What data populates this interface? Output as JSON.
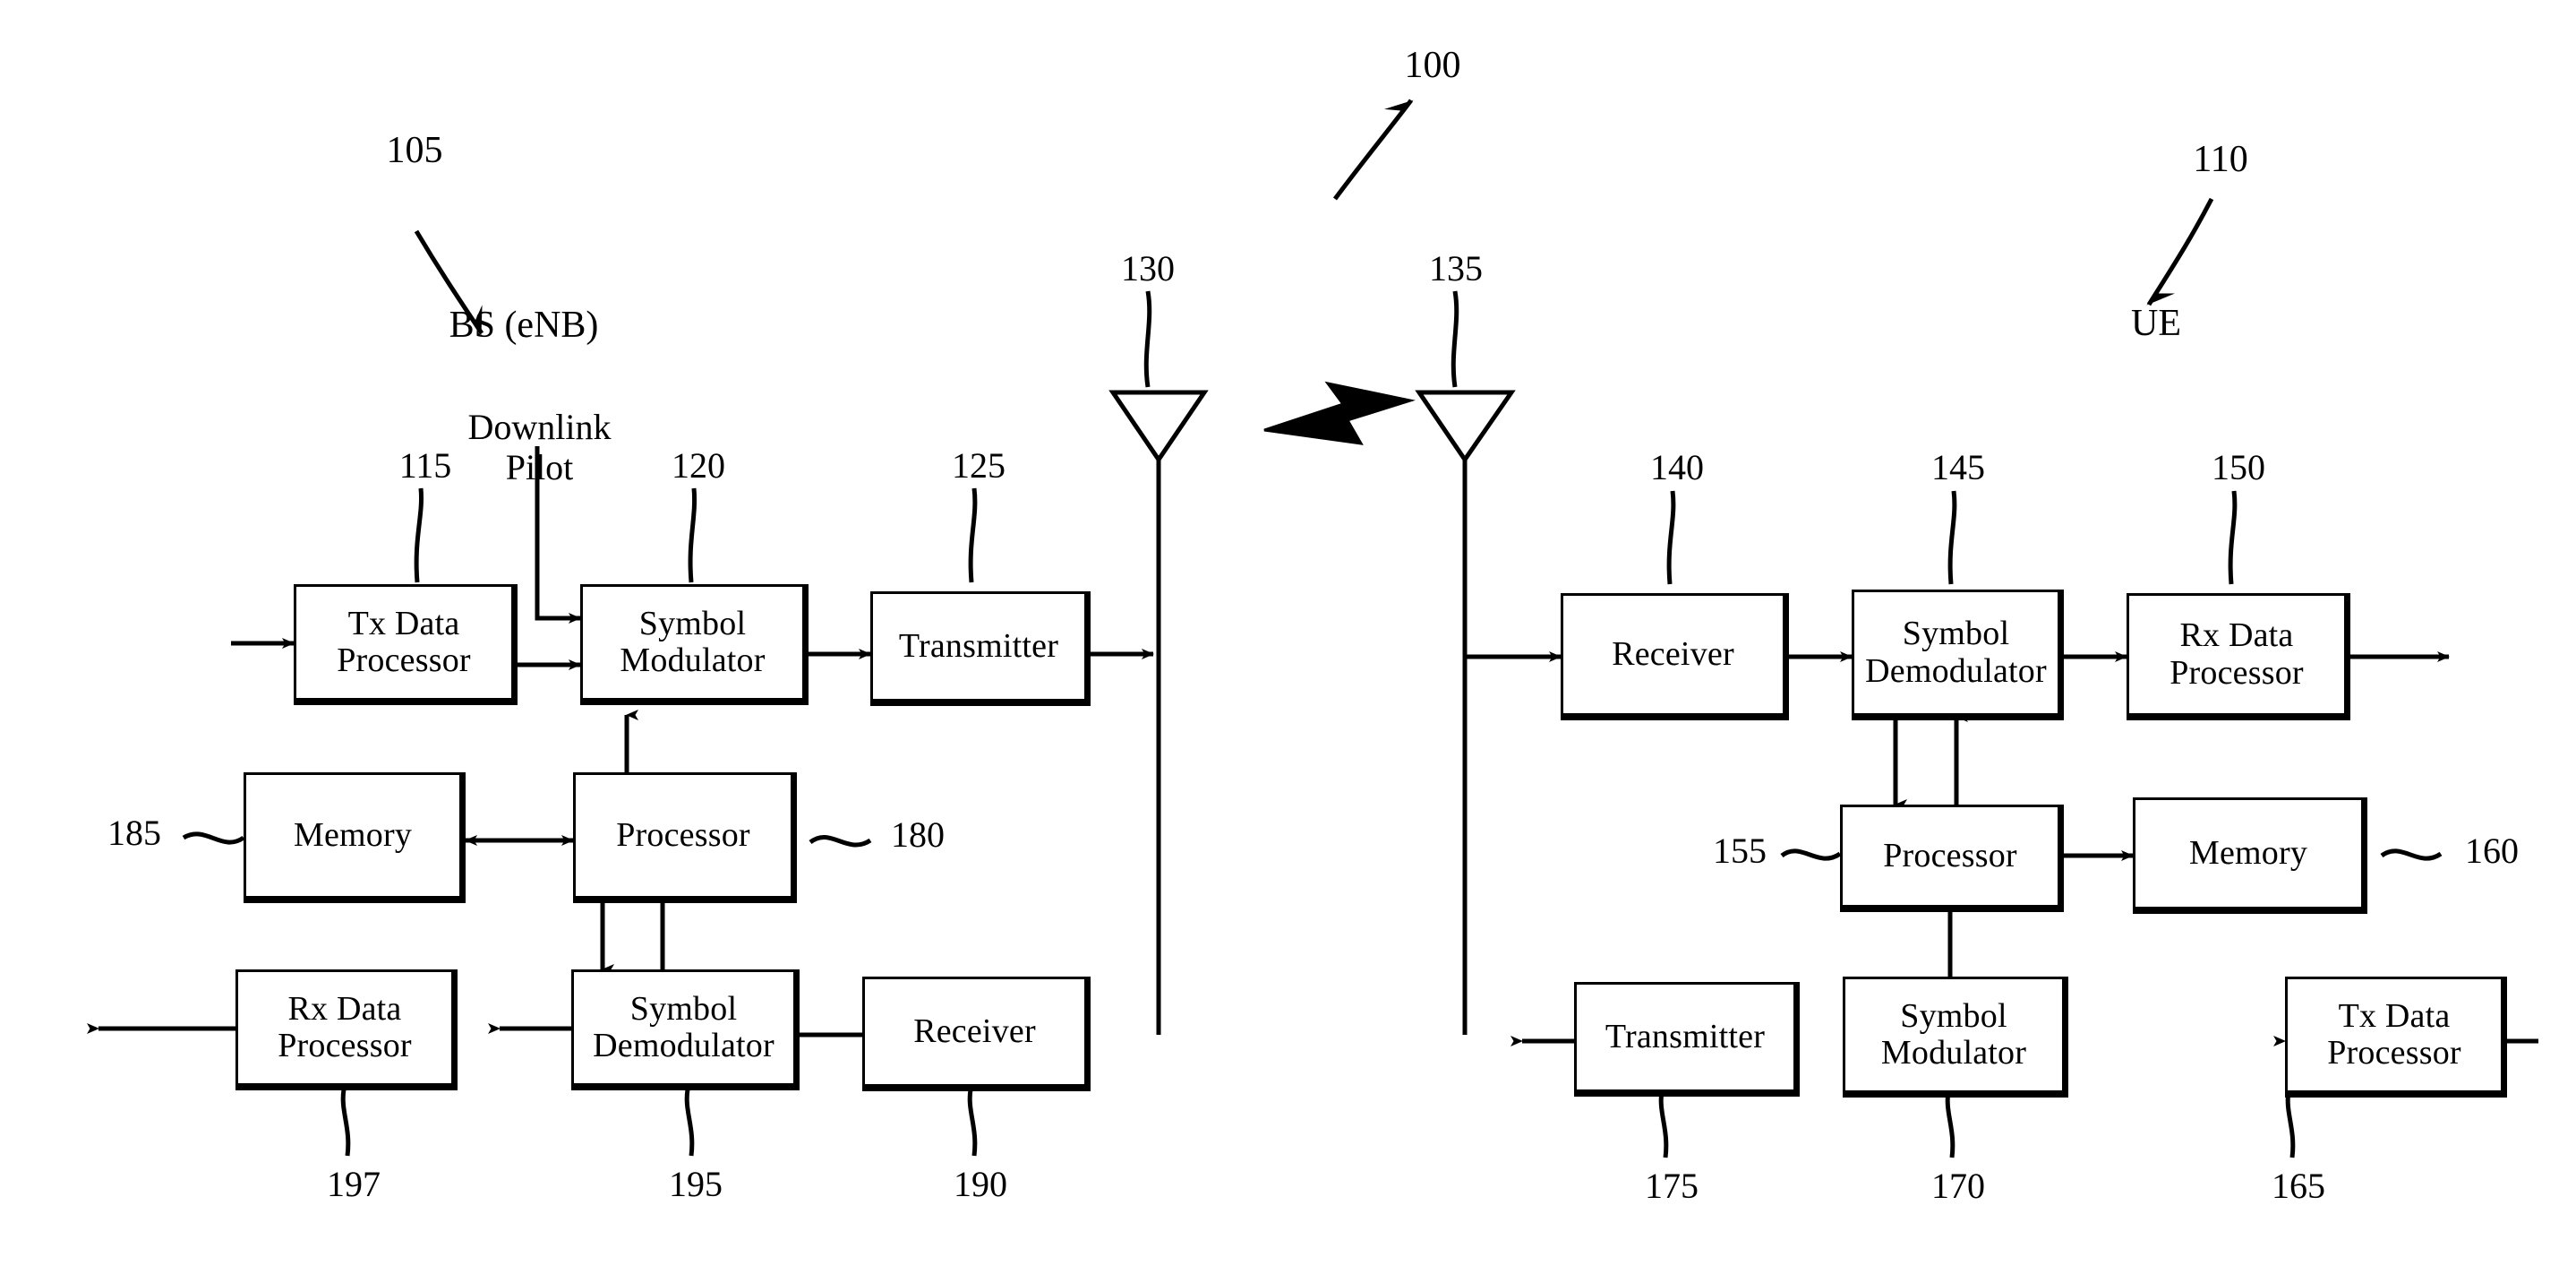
{
  "figure": {
    "title": "Wireless communication system block diagram",
    "system_label": "100",
    "bs_label": "BS (eNB)",
    "bs_ref": "105",
    "ue_label": "UE",
    "ue_ref": "110",
    "downlink_pilot_label": "Downlink\nPilot"
  },
  "bs": {
    "blocks": [
      {
        "id": "bs-tx-data-processor",
        "text": "Tx Data\nProcessor",
        "ref": "115"
      },
      {
        "id": "bs-symbol-modulator",
        "text": "Symbol\nModulator",
        "ref": "120"
      },
      {
        "id": "bs-transmitter",
        "text": "Transmitter",
        "ref": "125"
      },
      {
        "id": "bs-memory",
        "text": "Memory",
        "ref": "185"
      },
      {
        "id": "bs-processor",
        "text": "Processor",
        "ref": "180"
      },
      {
        "id": "bs-rx-data-processor",
        "text": "Rx Data\nProcessor",
        "ref": "197"
      },
      {
        "id": "bs-symbol-demodulator",
        "text": "Symbol\nDemodulator",
        "ref": "195"
      },
      {
        "id": "bs-receiver",
        "text": "Receiver",
        "ref": "190"
      }
    ],
    "antenna_ref": "130"
  },
  "ue": {
    "blocks": [
      {
        "id": "ue-receiver",
        "text": "Receiver",
        "ref": "140"
      },
      {
        "id": "ue-symbol-demodulator",
        "text": "Symbol\nDemodulator",
        "ref": "145"
      },
      {
        "id": "ue-rx-data-processor",
        "text": "Rx Data\nProcessor",
        "ref": "150"
      },
      {
        "id": "ue-processor",
        "text": "Processor",
        "ref": "155"
      },
      {
        "id": "ue-memory",
        "text": "Memory",
        "ref": "160"
      },
      {
        "id": "ue-transmitter",
        "text": "Transmitter",
        "ref": "175"
      },
      {
        "id": "ue-symbol-modulator",
        "text": "Symbol\nModulator",
        "ref": "170"
      },
      {
        "id": "ue-tx-data-processor",
        "text": "Tx Data\nProcessor",
        "ref": "165"
      }
    ],
    "antenna_ref": "135"
  },
  "colors": {
    "line": "#000000",
    "background": "#ffffff"
  }
}
